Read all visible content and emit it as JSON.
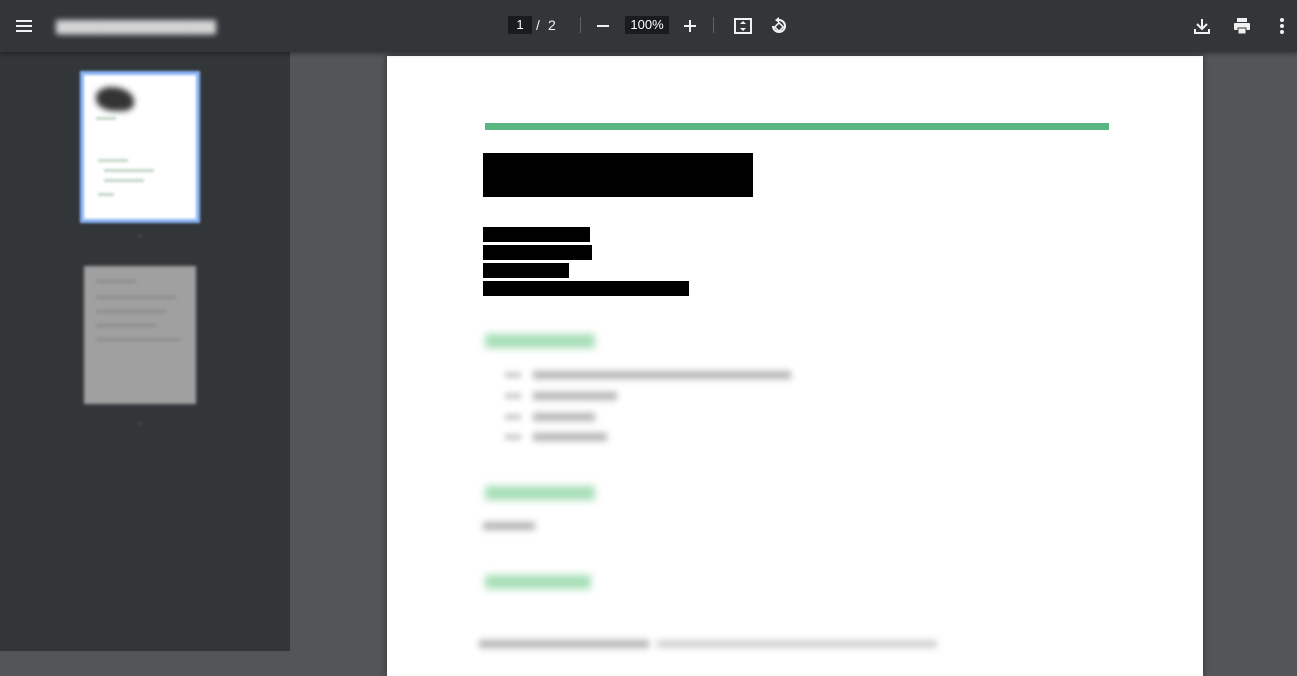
{
  "toolbar": {
    "menu_icon": "hamburger-menu-icon",
    "current_page": "1",
    "page_separator": "/",
    "total_pages": "2",
    "zoom_level": "100%",
    "icons": {
      "zoom_out": "minus-icon",
      "zoom_in": "plus-icon",
      "fit": "fit-to-page-icon",
      "rotate": "rotate-counterclockwise-icon",
      "download": "download-icon",
      "print": "print-icon",
      "more": "more-vertical-icon"
    }
  },
  "colors": {
    "toolbar_bg": "#323639",
    "viewer_bg": "#525659",
    "accent_green": "#5ab783",
    "thumb_selected": "#8ab4f8"
  }
}
